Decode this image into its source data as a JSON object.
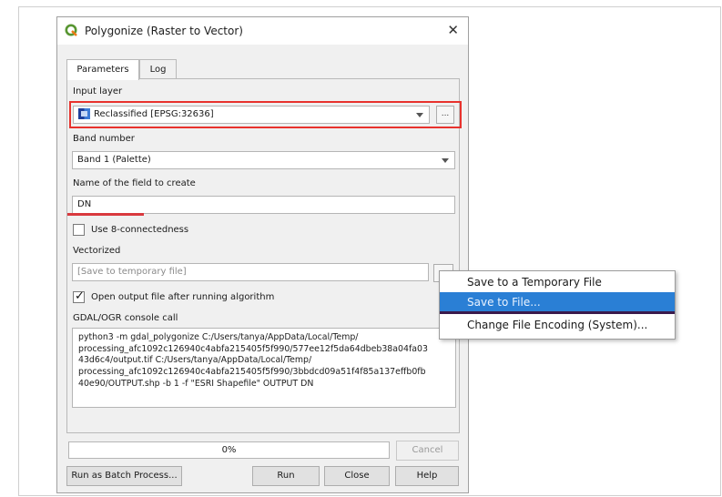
{
  "window": {
    "title": "Polygonize (Raster to Vector)",
    "close": "✕"
  },
  "tabs": [
    {
      "label": "Parameters"
    },
    {
      "label": "Log"
    }
  ],
  "input_layer": {
    "label": "Input layer",
    "value": "Reclassified [EPSG:32636]",
    "browse": "..."
  },
  "band": {
    "label": "Band number",
    "value": "Band 1 (Palette)"
  },
  "field_name": {
    "label": "Name of the field to create",
    "value": "DN"
  },
  "connectedness": {
    "label": "Use 8-connectedness",
    "checked": false
  },
  "vectorized": {
    "label": "Vectorized",
    "placeholder": "[Save to temporary file]"
  },
  "open_output": {
    "label": "Open output file after running algorithm",
    "checked": true
  },
  "console": {
    "label": "GDAL/OGR console call",
    "text": "python3 -m gdal_polygonize C:/Users/tanya/AppData/Local/Temp/\nprocessing_afc1092c126940c4abfa215405f5f990/577ee12f5da64dbeb38a04fa03\n43d6c4/output.tif C:/Users/tanya/AppData/Local/Temp/\nprocessing_afc1092c126940c4abfa215405f5f990/3bbdcd09a51f4f85a137effb0fb\n40e90/OUTPUT.shp -b 1 -f \"ESRI Shapefile\" OUTPUT DN"
  },
  "progress": {
    "text": "0%"
  },
  "buttons": {
    "cancel": "Cancel",
    "batch": "Run as Batch Process...",
    "run": "Run",
    "close": "Close",
    "help": "Help"
  },
  "context_menu": {
    "items": [
      {
        "label": "Save to a Temporary File"
      },
      {
        "label": "Save to File..."
      },
      {
        "label": "Change File Encoding (System)..."
      }
    ],
    "selected_index": 1
  },
  "colors": {
    "highlight": "#e8322d",
    "menu_selected": "#2a7fd5",
    "underline": "#d9393e"
  }
}
